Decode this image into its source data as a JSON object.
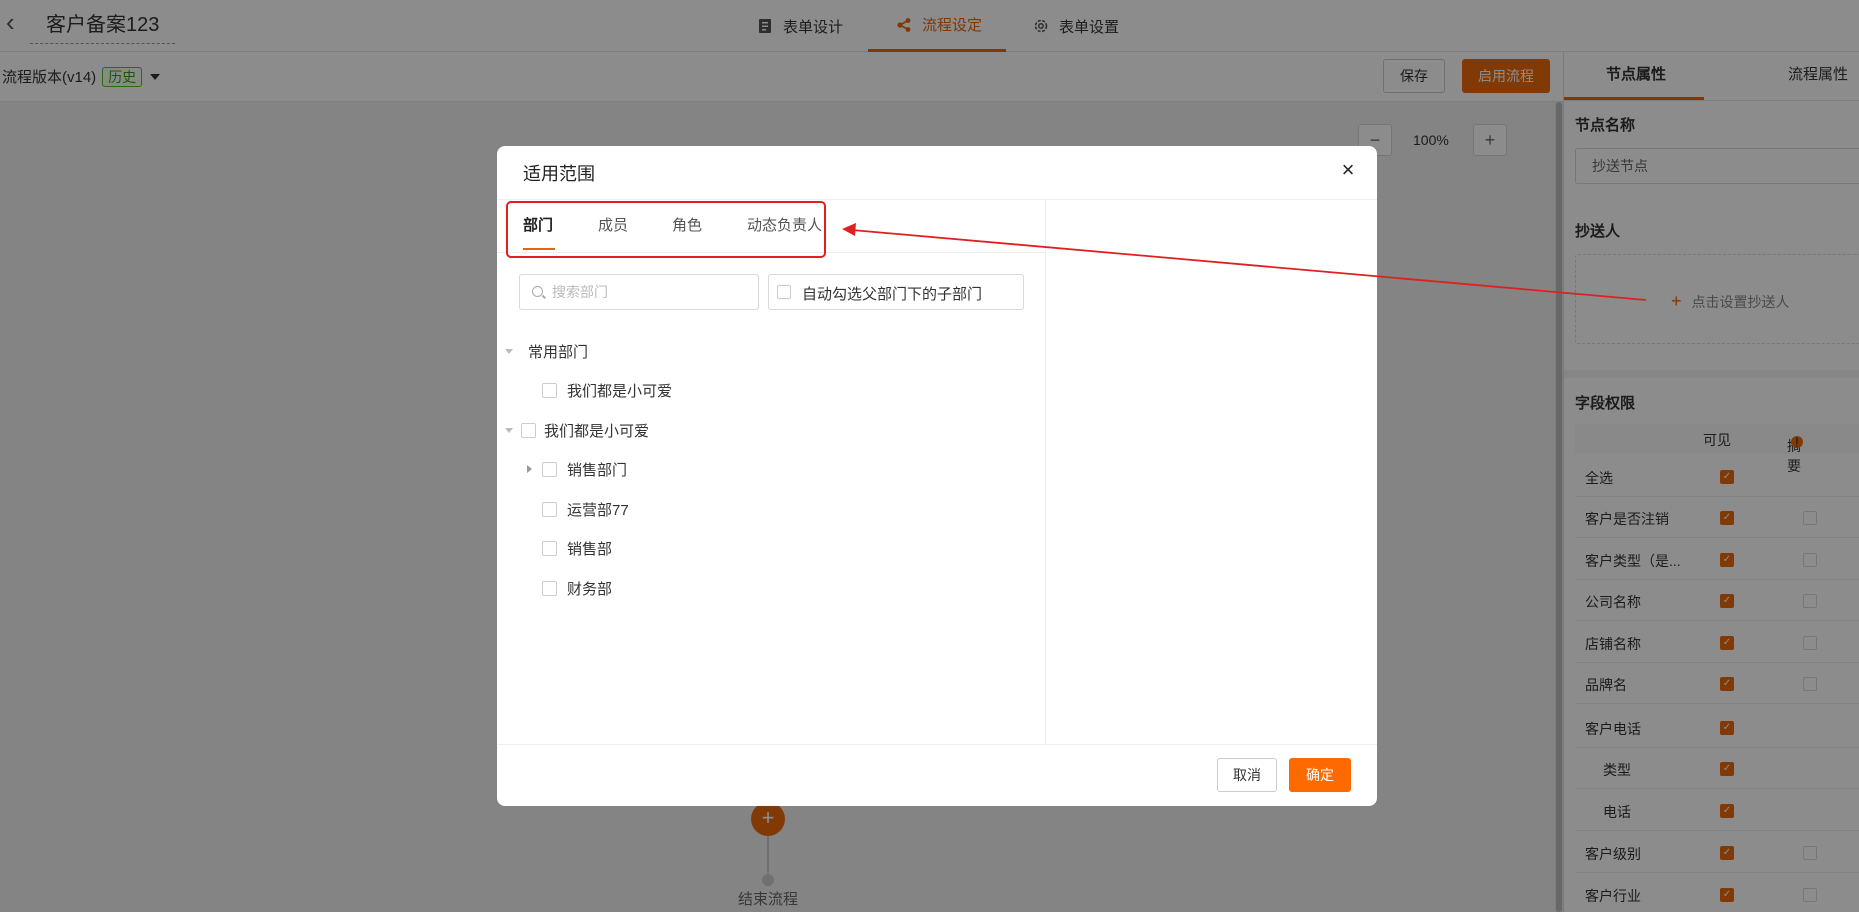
{
  "header": {
    "back_glyph": "‹",
    "title": "客户备案123",
    "tabs": [
      {
        "label": "表单设计",
        "icon": "form-icon"
      },
      {
        "label": "流程设定",
        "icon": "flow-icon"
      },
      {
        "label": "表单设置",
        "icon": "settings-icon"
      }
    ],
    "active_tab": "流程设定",
    "accent_color": "#e8660b"
  },
  "toolbar": {
    "version": "流程版本(v14)",
    "history_badge": "历史",
    "save_label": "保存",
    "enable_label": "启用流程"
  },
  "canvas": {
    "zoom_out": "−",
    "zoom_level": "100%",
    "zoom_in": "+",
    "add_node": "+",
    "end_label": "结束流程"
  },
  "right_panel": {
    "tabs": [
      "节点属性",
      "流程属性"
    ],
    "node_name_title": "节点名称",
    "node_name_value": "抄送节点",
    "cc_title": "抄送人",
    "cc_plus": "+",
    "cc_placeholder": "点击设置抄送人",
    "perm_title": "字段权限",
    "col_visible": "可见",
    "col_summary": "摘要",
    "warn_mark": "!",
    "check_glyph": "✓",
    "fields": [
      {
        "label": "全选",
        "visible": true,
        "summary": null
      },
      {
        "label": "客户是否注销",
        "visible": true,
        "summary": false
      },
      {
        "label": "客户类型（是...",
        "visible": true,
        "summary": false
      },
      {
        "label": "公司名称",
        "visible": true,
        "summary": false
      },
      {
        "label": "店铺名称",
        "visible": true,
        "summary": false
      },
      {
        "label": "品牌名",
        "visible": true,
        "summary": false
      },
      {
        "label": "客户电话",
        "visible": true,
        "summary": null
      },
      {
        "label": "类型",
        "visible": true,
        "summary": null,
        "sub": true
      },
      {
        "label": "电话",
        "visible": true,
        "summary": null,
        "sub": true
      },
      {
        "label": "客户级别",
        "visible": true,
        "summary": false
      },
      {
        "label": "客户行业",
        "visible": true,
        "summary": false
      }
    ]
  },
  "modal": {
    "title": "适用范围",
    "close_glyph": "×",
    "tabs": [
      "部门",
      "成员",
      "角色",
      "动态负责人"
    ],
    "active_tab": "部门",
    "search_placeholder": "搜索部门",
    "auto_select_label": "自动勾选父部门下的子部门",
    "tree": {
      "common_group": "常用部门",
      "common_items": [
        "我们都是小可爱"
      ],
      "root": "我们都是小可爱",
      "children": [
        "销售部门",
        "运营部77",
        "销售部",
        "财务部"
      ]
    },
    "cancel_label": "取消",
    "ok_label": "确定"
  },
  "annotation": {
    "highlight_color": "#e02020"
  }
}
